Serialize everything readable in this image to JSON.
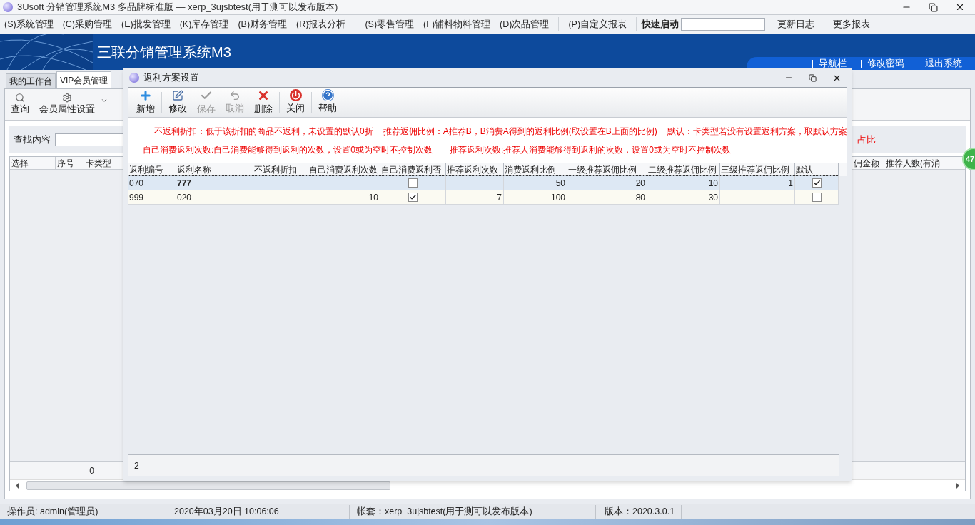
{
  "window": {
    "title": "3Usoft 分销管理系统M3 多品牌标准版 — xerp_3ujsbtest(用于测可以发布版本)"
  },
  "menu_bar": {
    "items": [
      "(S)系统管理",
      "(C)采购管理",
      "(E)批发管理",
      "(K)库存管理",
      "(B)财务管理",
      "(R)报表分析",
      "(S)零售管理",
      "(F)辅料物料管理",
      "(D)次品管理",
      "(P)自定义报表"
    ],
    "quick_launch": {
      "label": "快速启动"
    },
    "links": [
      "更新日志",
      "更多报表"
    ]
  },
  "banner": {
    "title": "三联分销管理系统M3",
    "links": [
      "导航栏",
      "修改密码",
      "退出系统"
    ]
  },
  "tabs": [
    {
      "label": "我的工作台",
      "selected": false
    },
    {
      "label": "VIP会员管理",
      "selected": true
    }
  ],
  "toolbar": [
    "查询",
    "会员属性设置"
  ],
  "search": {
    "label": "查找内容"
  },
  "hint_tail": "占比",
  "table": {
    "columns_left": [
      "选择",
      "序号",
      "卡类型"
    ],
    "columns_right": [
      "佣金额",
      "推荐人数(有消"
    ],
    "footer": "0"
  },
  "badge": "47",
  "dialog": {
    "title": "返利方案设置",
    "toolbar": [
      {
        "label": "新增",
        "kind": "add",
        "disabled": false
      },
      {
        "label": "修改",
        "kind": "edit",
        "disabled": false
      },
      {
        "label": "保存",
        "kind": "save",
        "disabled": true
      },
      {
        "label": "取消",
        "kind": "undo",
        "disabled": true
      },
      {
        "label": "删除",
        "kind": "delete",
        "disabled": false
      },
      {
        "label": "关闭",
        "kind": "close",
        "disabled": false
      },
      {
        "label": "帮助",
        "kind": "help",
        "disabled": false
      }
    ],
    "notes": [
      [
        "不返利折扣：低于该折扣的商品不返利，未设置的默认0折",
        "推荐返佣比例：A推荐B，B消费A得到的返利比例(取设置在B上面的比例)",
        "默认：卡类型若没有设置返利方案，取默认方案"
      ],
      [
        "自己消费返利次数:自己消费能够得到返利的次数，设置0或为空时不控制次数",
        "推荐返利次数:推荐人消费能够得到返利的次数，设置0或为空时不控制次数"
      ]
    ],
    "columns": [
      {
        "label": "返利编号",
        "kind": "text"
      },
      {
        "label": "返利名称",
        "kind": "text"
      },
      {
        "label": "不返利折扣",
        "kind": "number"
      },
      {
        "label": "自己消费返利次数",
        "kind": "number"
      },
      {
        "label": "自己消费返利否",
        "kind": "check"
      },
      {
        "label": "推荐返利次数",
        "kind": "number"
      },
      {
        "label": "消费返利比例",
        "kind": "number"
      },
      {
        "label": "一级推荐返佣比例",
        "kind": "number"
      },
      {
        "label": "二级推荐返佣比例",
        "kind": "number"
      },
      {
        "label": "三级推荐返佣比例",
        "kind": "number"
      },
      {
        "label": "默认",
        "kind": "check"
      }
    ],
    "rows": [
      {
        "selected": true,
        "cells": [
          "070",
          "777",
          null,
          null,
          false,
          null,
          "50",
          "20",
          "10",
          "1",
          true
        ]
      },
      {
        "selected": false,
        "cells": [
          "999",
          "020",
          null,
          "10",
          true,
          "7",
          "100",
          "80",
          "30",
          null,
          false
        ]
      }
    ],
    "footer": "2"
  },
  "status_bar": [
    "操作员: admin(管理员)",
    "2020年03月20日 10:06:06",
    "帐套：xerp_3ujsbtest(用于测可以发布版本)",
    "版本：2020.3.0.1"
  ]
}
